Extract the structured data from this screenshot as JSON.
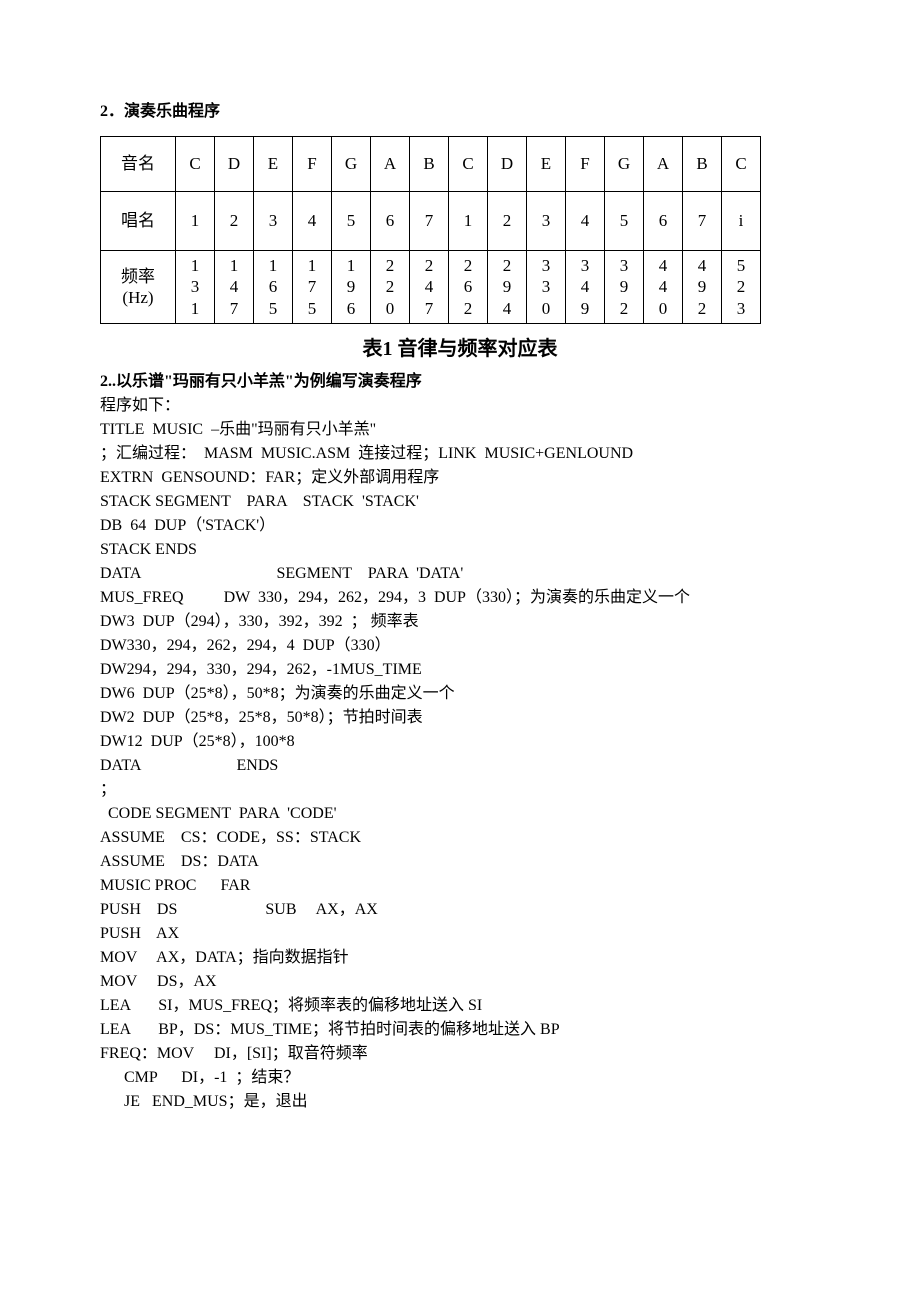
{
  "section_title": "2．演奏乐曲程序",
  "table": {
    "row_headers": {
      "note": "音名",
      "sing": "唱名",
      "freq": "频率 (Hz)"
    },
    "notes": [
      "C",
      "D",
      "E",
      "F",
      "G",
      "A",
      "B",
      "C",
      "D",
      "E",
      "F",
      "G",
      "A",
      "B",
      "C"
    ],
    "sing": [
      "1",
      "2",
      "3",
      "4",
      "5",
      "6",
      "7",
      "1",
      "2",
      "3",
      "4",
      "5",
      "6",
      "7",
      "i"
    ],
    "freq": [
      "131",
      "147",
      "165",
      "175",
      "196",
      "220",
      "247",
      "262",
      "294",
      "330",
      "349",
      "392",
      "440",
      "492",
      "523"
    ]
  },
  "chart_data": {
    "type": "table",
    "title": "表1 音律与频率对应表",
    "columns": [
      "音名",
      "唱名",
      "频率 (Hz)"
    ],
    "rows": [
      {
        "音名": "C",
        "唱名": "1",
        "频率": 131
      },
      {
        "音名": "D",
        "唱名": "2",
        "频率": 147
      },
      {
        "音名": "E",
        "唱名": "3",
        "频率": 165
      },
      {
        "音名": "F",
        "唱名": "4",
        "频率": 175
      },
      {
        "音名": "G",
        "唱名": "5",
        "频率": 196
      },
      {
        "音名": "A",
        "唱名": "6",
        "频率": 220
      },
      {
        "音名": "B",
        "唱名": "7",
        "频率": 247
      },
      {
        "音名": "C",
        "唱名": "1",
        "频率": 262
      },
      {
        "音名": "D",
        "唱名": "2",
        "频率": 294
      },
      {
        "音名": "E",
        "唱名": "3",
        "频率": 330
      },
      {
        "音名": "F",
        "唱名": "4",
        "频率": 349
      },
      {
        "音名": "G",
        "唱名": "5",
        "频率": 392
      },
      {
        "音名": "A",
        "唱名": "6",
        "频率": 440
      },
      {
        "音名": "B",
        "唱名": "7",
        "频率": 492
      },
      {
        "音名": "C",
        "唱名": "i",
        "频率": 523
      }
    ]
  },
  "caption": "表1 音律与频率对应表",
  "subsection": "2..以乐谱\"玛丽有只小羊羔\"为例编写演奏程序",
  "intro": "程序如下：",
  "code_lines": [
    "TITLE  MUSIC  –乐曲\"玛丽有只小羊羔\"",
    "；汇编过程：  MASM  MUSIC.ASM  连接过程；LINK  MUSIC+GENLOUND",
    "EXTRN  GENSOUND：FAR；定义外部调用程序",
    "STACK SEGMENT    PARA    STACK  'STACK'",
    "DB  64  DUP（'STACK'）",
    "STACK ENDS",
    "DATA                                  SEGMENT    PARA  'DATA'",
    "MUS_FREQ          DW  330，294，262，294，3  DUP（330）；为演奏的乐曲定义一个",
    "DW3  DUP（294），330，392，392  ； 频率表",
    "DW330，294，262，294，4  DUP（330）",
    "DW294，294，330，294，262，-1MUS_TIME",
    "DW6  DUP（25*8），50*8；为演奏的乐曲定义一个",
    "DW2  DUP（25*8，25*8，50*8）；节拍时间表",
    "DW12  DUP（25*8），100*8",
    "DATA                        ENDS",
    "；",
    "  CODE SEGMENT  PARA  'CODE'",
    "ASSUME    CS：CODE，SS：STACK",
    "ASSUME    DS：DATA",
    "MUSIC PROC      FAR",
    "PUSH    DS                      SUB     AX，AX",
    "PUSH    AX",
    "MOV     AX，DATA；指向数据指针",
    "MOV     DS，AX",
    "LEA       SI，MUS_FREQ；将频率表的偏移地址送入 SI",
    "LEA       BP，DS：MUS_TIME；将节拍时间表的偏移地址送入 BP",
    "FREQ：MOV     DI，[SI]；取音符频率",
    "      CMP      DI，-1  ；结束？",
    "      JE   END_MUS；是，退出"
  ]
}
